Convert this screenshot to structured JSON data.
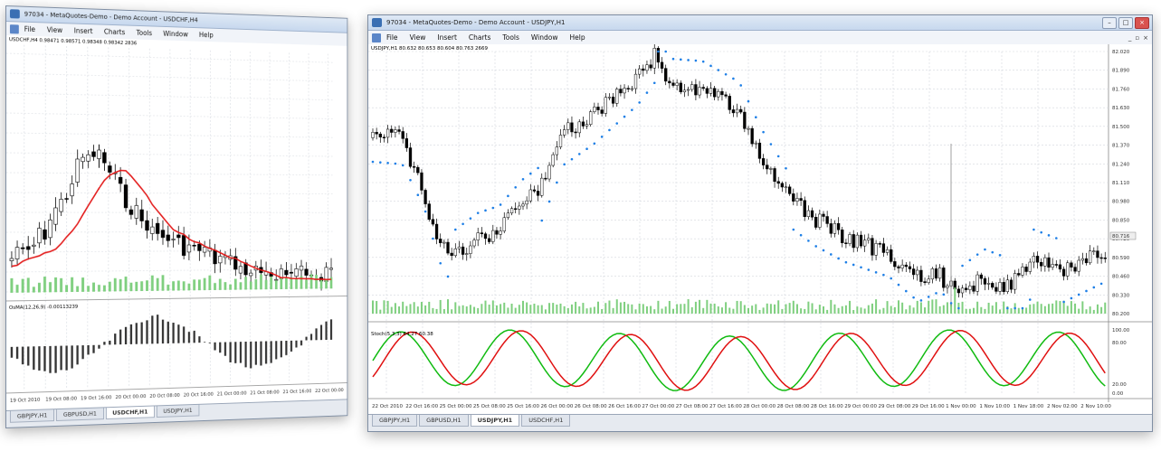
{
  "windows": [
    {
      "title": "97034 - MetaQuotes-Demo - Demo Account - USDCHF,H4",
      "menu": [
        "File",
        "View",
        "Insert",
        "Charts",
        "Tools",
        "Window",
        "Help"
      ],
      "symbol_info": "USDCHF,H4 0.98471 0.98571 0.98348 0.98342 2836",
      "indicator_label": "OsMA(12,26,9) -0.00113239",
      "time_labels": [
        "19 Oct 2010",
        "19 Oct 08:00",
        "19 Oct 16:00",
        "20 Oct 00:00",
        "20 Oct 08:00",
        "20 Oct 16:00",
        "21 Oct 00:00",
        "21 Oct 08:00",
        "21 Oct 16:00",
        "22 Oct 00:00"
      ],
      "tabs": [
        {
          "label": "GBPJPY,H1",
          "active": false
        },
        {
          "label": "GBPUSD,H1",
          "active": false
        },
        {
          "label": "USDCHF,H1",
          "active": true
        },
        {
          "label": "USDJPY,H1",
          "active": false
        }
      ]
    },
    {
      "title": "97034 - MetaQuotes-Demo - Demo Account - USDJPY,H1",
      "menu": [
        "File",
        "View",
        "Insert",
        "Charts",
        "Tools",
        "Window",
        "Help"
      ],
      "symbol_info": "USDJPY,H1 80.632 80.653 80.604 80.763 2669",
      "indicator_label": "Stoch(5,3,3) 64.27 60.38",
      "price_labels": [
        "82.020",
        "81.890",
        "81.760",
        "81.630",
        "81.500",
        "81.370",
        "81.240",
        "81.110",
        "80.980",
        "80.850",
        "80.720",
        "80.590",
        "80.460",
        "80.330",
        "80.200"
      ],
      "current_price": "80.716",
      "stoch_levels": [
        "100.00",
        "80.00",
        "20.00",
        "0.00"
      ],
      "time_labels": [
        "22 Oct 2010",
        "22 Oct 16:00",
        "25 Oct 00:00",
        "25 Oct 08:00",
        "25 Oct 16:00",
        "26 Oct 00:00",
        "26 Oct 08:00",
        "26 Oct 16:00",
        "27 Oct 00:00",
        "27 Oct 08:00",
        "27 Oct 16:00",
        "28 Oct 00:00",
        "28 Oct 08:00",
        "28 Oct 16:00",
        "29 Oct 00:00",
        "29 Oct 08:00",
        "29 Oct 16:00",
        "1 Nov 00:00",
        "1 Nov 10:00",
        "1 Nov 18:00",
        "2 Nov 02:00",
        "2 Nov 10:00"
      ],
      "tabs": [
        {
          "label": "GBPJPY,H1",
          "active": false
        },
        {
          "label": "GBPUSD,H1",
          "active": false
        },
        {
          "label": "USDJPY,H1",
          "active": true
        },
        {
          "label": "USDCHF,H1",
          "active": false
        }
      ]
    }
  ],
  "colors": {
    "bull": "#ffffff",
    "bear": "#000000",
    "ma": "#e31b1b",
    "sar": "#1e7fe6",
    "volume": "#7fcf7f",
    "stoch_main": "#11bb11",
    "stoch_signal": "#e01010",
    "grid": "#d3d7de",
    "titlebar": "#c7d8ee"
  }
}
